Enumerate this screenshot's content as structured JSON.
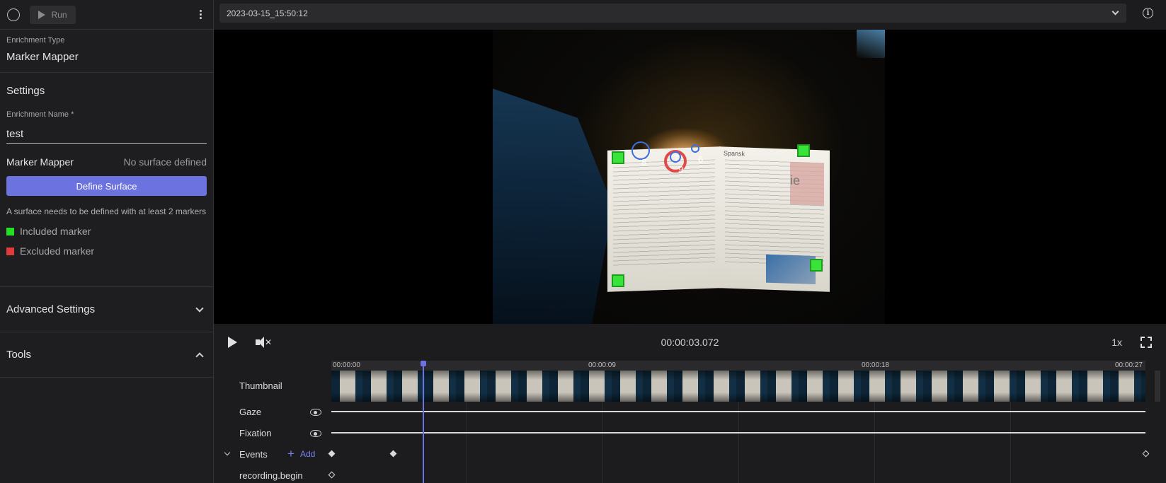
{
  "toolbar": {
    "run_label": "Run"
  },
  "enrichment": {
    "type_label": "Enrichment Type",
    "type_value": "Marker Mapper"
  },
  "settings": {
    "heading": "Settings",
    "name_label": "Enrichment Name *",
    "name_value": "test",
    "marker_mapper_title": "Marker Mapper",
    "surface_status": "No surface defined",
    "define_button": "Define Surface",
    "hint": "A surface needs to be defined with at least 2 markers",
    "legend": [
      {
        "label": "Included marker",
        "color": "#22e022"
      },
      {
        "label": "Excluded marker",
        "color": "#e03a3a"
      }
    ]
  },
  "advanced_settings_label": "Advanced Settings",
  "tools_label": "Tools",
  "recording": {
    "selected": "2023-03-15_15:50:12"
  },
  "video": {
    "gaze_labels": [
      "8",
      "7",
      "9",
      "6"
    ],
    "menu_headings": [
      "Spansk",
      "ie"
    ]
  },
  "player": {
    "current_time": "00:00:03.072",
    "speed": "1x"
  },
  "timeline": {
    "ticks": [
      "00:00:00",
      "00:00:09",
      "00:00:18",
      "00:00:27"
    ],
    "rows": {
      "thumbnail": "Thumbnail",
      "gaze": "Gaze",
      "fixation": "Fixation",
      "events": "Events",
      "add": "Add",
      "recording_begin": "recording.begin"
    }
  },
  "colors": {
    "accent": "#6c73e0",
    "included_marker": "#22e022",
    "excluded_marker": "#e03a3a"
  }
}
